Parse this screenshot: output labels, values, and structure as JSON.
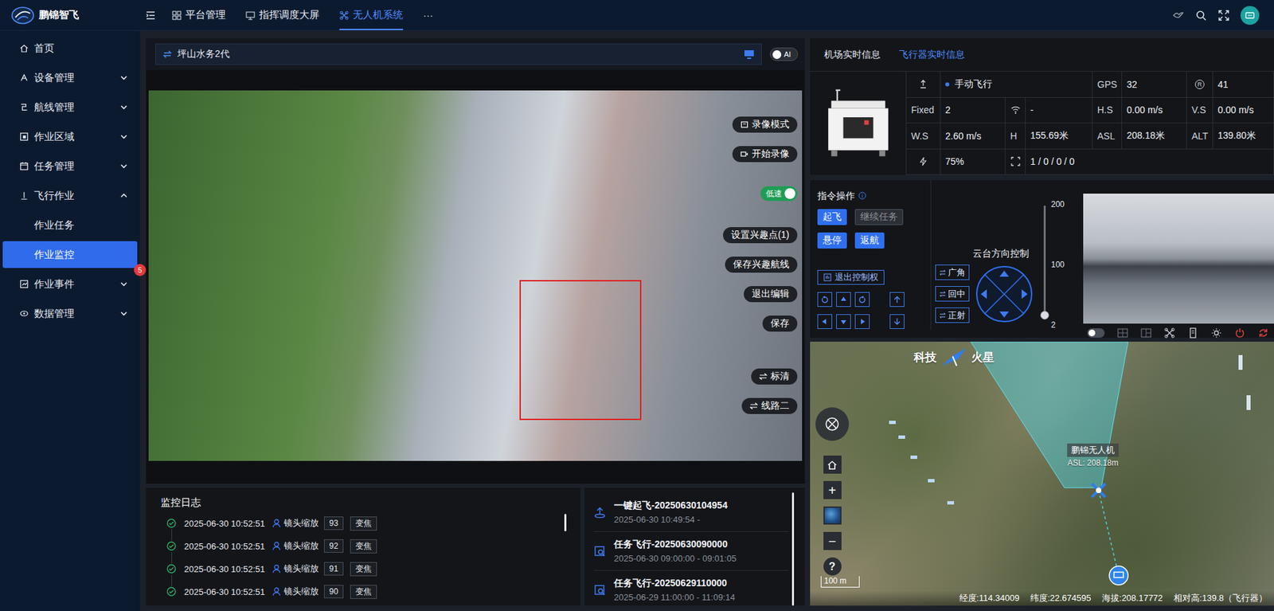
{
  "header": {
    "brand": "鹏锦智飞",
    "tabs": [
      {
        "label": "平台管理",
        "selected": false
      },
      {
        "label": "指挥调度大屏",
        "selected": false
      },
      {
        "label": "无人机系统",
        "selected": true
      }
    ],
    "more": "···"
  },
  "sidebar": {
    "items": [
      {
        "label": "首页",
        "kind": "link",
        "expanded": false,
        "selected": false,
        "badge": ""
      },
      {
        "label": "设备管理",
        "kind": "group",
        "expanded": false,
        "selected": false,
        "badge": ""
      },
      {
        "label": "航线管理",
        "kind": "group",
        "expanded": false,
        "selected": false,
        "badge": ""
      },
      {
        "label": "作业区域",
        "kind": "group",
        "expanded": false,
        "selected": false,
        "badge": ""
      },
      {
        "label": "任务管理",
        "kind": "group",
        "expanded": false,
        "selected": false,
        "badge": ""
      },
      {
        "label": "飞行作业",
        "kind": "group",
        "expanded": true,
        "selected": false,
        "badge": ""
      },
      {
        "label": "作业任务",
        "kind": "sub",
        "expanded": false,
        "selected": false,
        "badge": ""
      },
      {
        "label": "作业监控",
        "kind": "sub",
        "expanded": false,
        "selected": true,
        "badge": "5"
      },
      {
        "label": "作业事件",
        "kind": "group",
        "expanded": false,
        "selected": false,
        "badge": ""
      },
      {
        "label": "数据管理",
        "kind": "group",
        "expanded": false,
        "selected": false,
        "badge": ""
      }
    ]
  },
  "video": {
    "source": "坪山水务2代",
    "ai": {
      "label": "AI",
      "on": false
    },
    "target_box": true,
    "record_buttons": [
      "录像模式",
      "开始录像"
    ],
    "speed": {
      "label": "低速",
      "on": true
    },
    "edit_buttons": [
      "设置兴趣点(1)",
      "保存兴趣航线",
      "退出编辑",
      "保存"
    ],
    "stream_buttons": [
      "标清",
      "线路二"
    ]
  },
  "log": {
    "title": "监控日志",
    "rows": [
      {
        "time": "2025-06-30 10:52:51",
        "action": "镜头缩放",
        "value": "93",
        "tag": "变焦",
        "ok": true
      },
      {
        "time": "2025-06-30 10:52:51",
        "action": "镜头缩放",
        "value": "92",
        "tag": "变焦",
        "ok": true
      },
      {
        "time": "2025-06-30 10:52:51",
        "action": "镜头缩放",
        "value": "91",
        "tag": "变焦",
        "ok": true
      },
      {
        "time": "2025-06-30 10:52:51",
        "action": "镜头缩放",
        "value": "90",
        "tag": "变焦",
        "ok": true
      }
    ]
  },
  "records": [
    {
      "title": "一键起飞-20250630104954",
      "time": "2025-06-30 10:49:54 -",
      "kind": "takeoff"
    },
    {
      "title": "任务飞行-20250630090000",
      "time": "2025-06-30 09:00:00 - 09:01:05",
      "kind": "mission"
    },
    {
      "title": "任务飞行-20250629110000",
      "time": "2025-06-29 11:00:00 - 11:09:14",
      "kind": "mission"
    }
  ],
  "aircraft": {
    "tabs": [
      {
        "label": "机场实时信息",
        "selected": false
      },
      {
        "label": "飞行器实时信息",
        "selected": true
      }
    ],
    "telemetry": {
      "mode": {
        "text": "手动飞行",
        "color": "#3d7bf0"
      },
      "gps": {
        "label": "GPS",
        "value": "32"
      },
      "rtk": {
        "label": "R",
        "value": "41"
      },
      "fixed": {
        "label": "Fixed",
        "value": "2"
      },
      "signal": {
        "value": "-"
      },
      "hs": {
        "label": "H.S",
        "value": "0.00 m/s"
      },
      "vs": {
        "label": "V.S",
        "value": "0.00 m/s"
      },
      "ws": {
        "label": "W.S",
        "value": "2.60 m/s"
      },
      "h": {
        "label": "H",
        "value": "155.69米"
      },
      "asl": {
        "label": "ASL",
        "value": "208.18米"
      },
      "alt": {
        "label": "ALT",
        "value": "139.80米"
      },
      "battery": {
        "value": "75%"
      },
      "counts": {
        "value": "1 / 0 / 0 / 0"
      }
    }
  },
  "commands": {
    "title": "指令操作",
    "buttons": [
      {
        "label": "起飞",
        "disabled": false
      },
      {
        "label": "继续任务",
        "disabled": true
      },
      {
        "label": "悬停",
        "disabled": false
      },
      {
        "label": "返航",
        "disabled": false
      }
    ],
    "release": "退出控制权",
    "gimbal": {
      "title": "云台方向控制",
      "buttons": [
        "广角",
        "回中",
        "正射"
      ]
    },
    "zoom": {
      "ticks": [
        "200",
        "100",
        "2"
      ],
      "level": 0
    },
    "pip_on": false
  },
  "map": {
    "watermark": {
      "left": "科技",
      "right": "火星"
    },
    "drone": {
      "name": "鹏锦无人机",
      "asl": "ASL: 208.18m"
    },
    "controls": {
      "zoom_in": "+",
      "zoom_out": "−",
      "help": "?"
    },
    "scale": "100 m",
    "status": [
      "经度:114.34009",
      "纬度:22.674595",
      "海拔:208.17772",
      "相对高:139.8（飞行器）"
    ]
  }
}
